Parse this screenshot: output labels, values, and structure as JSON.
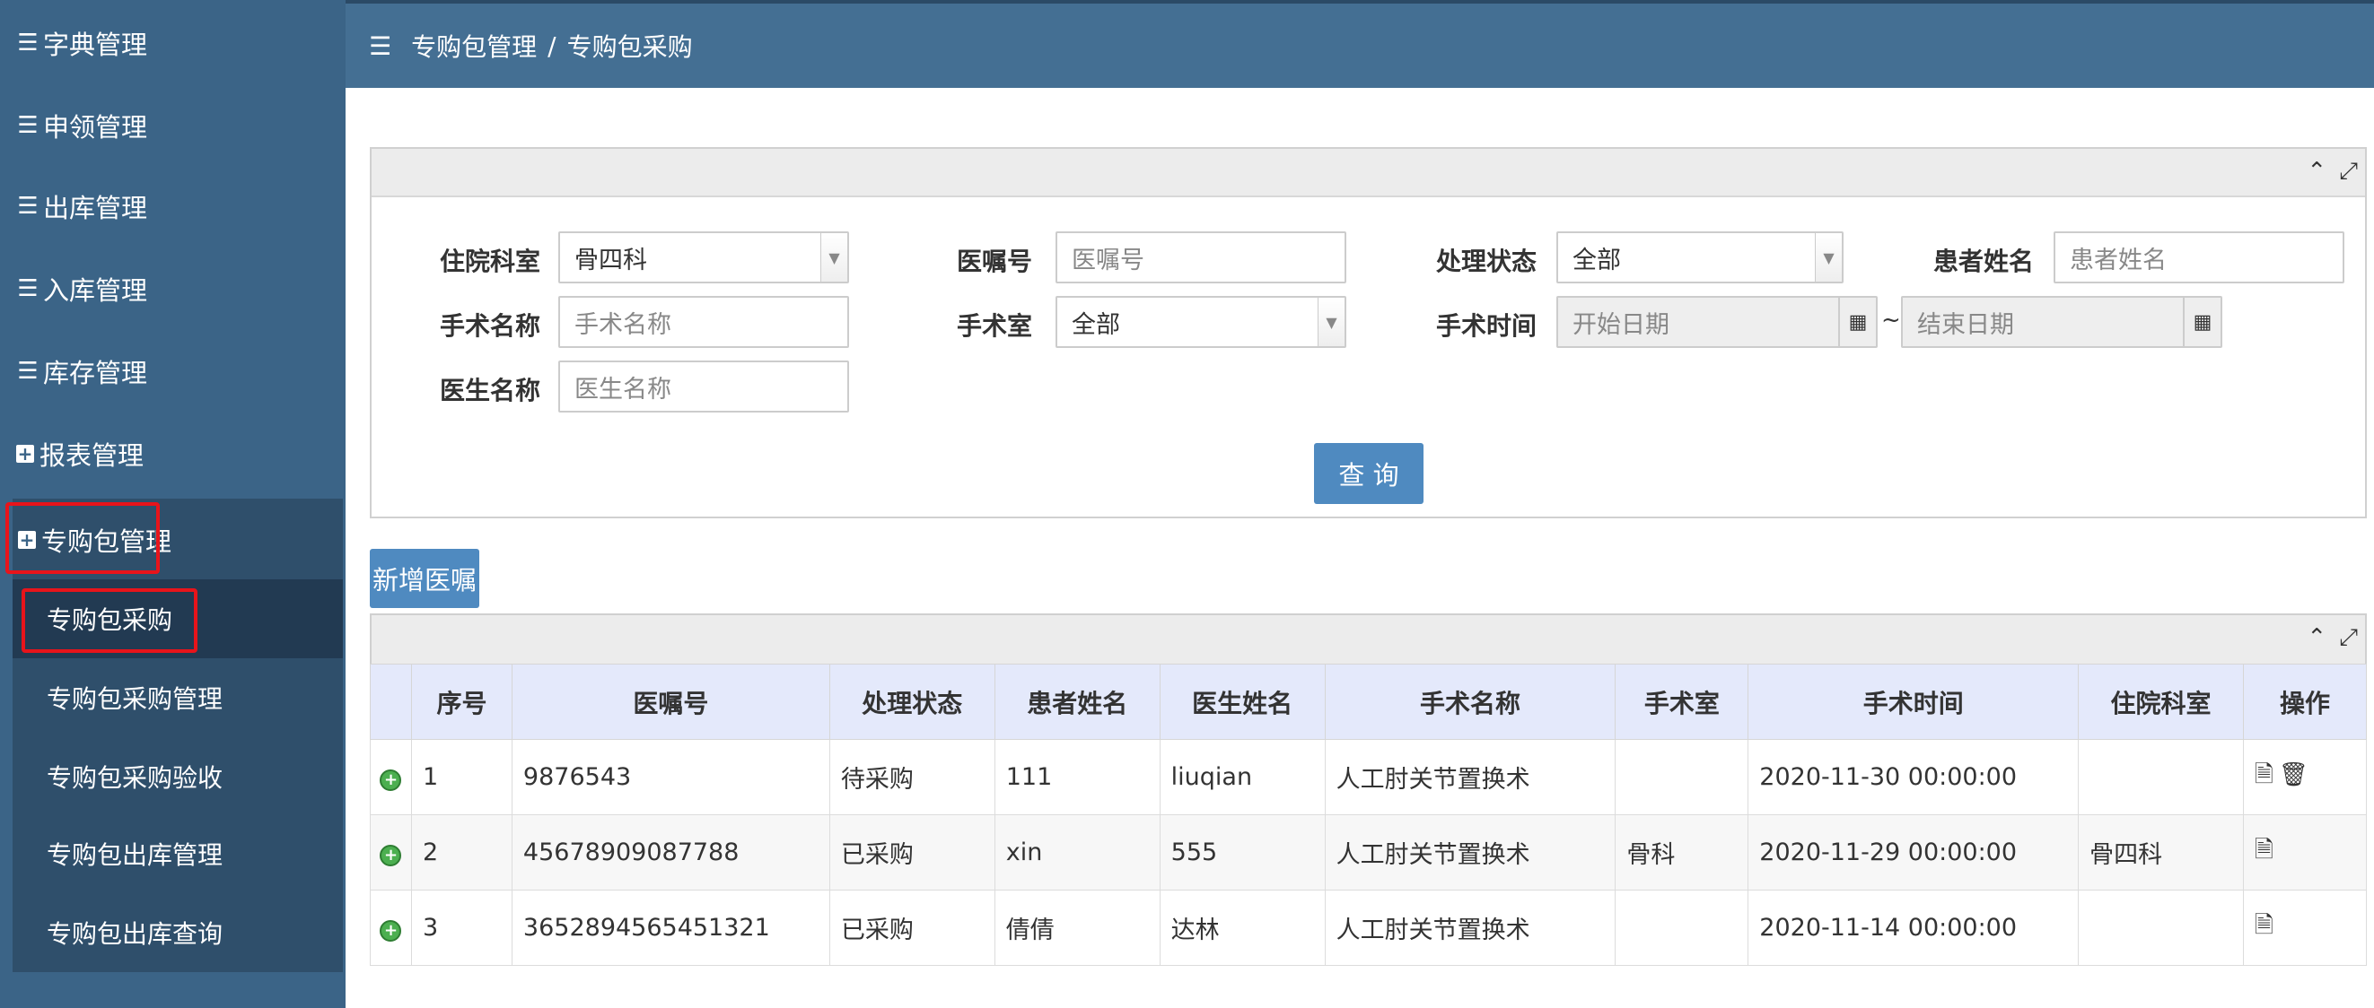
{
  "sidebar": {
    "items": [
      {
        "label": "字典管理",
        "icon": "list-icon"
      },
      {
        "label": "申领管理",
        "icon": "list-icon"
      },
      {
        "label": "出库管理",
        "icon": "list-icon"
      },
      {
        "label": "入库管理",
        "icon": "list-icon"
      },
      {
        "label": "库存管理",
        "icon": "list-icon"
      },
      {
        "label": "报表管理",
        "icon": "plus-box-icon"
      },
      {
        "label": "专购包管理",
        "icon": "plus-box-icon"
      }
    ],
    "subitems": [
      {
        "label": "专购包采购"
      },
      {
        "label": "专购包采购管理"
      },
      {
        "label": "专购包采购验收"
      },
      {
        "label": "专购包出库管理"
      },
      {
        "label": "专购包出库查询"
      }
    ]
  },
  "breadcrumb": {
    "parent": "专购包管理",
    "separator": "/",
    "current": "专购包采购"
  },
  "search": {
    "ward": {
      "label": "住院科室",
      "value": "骨四科"
    },
    "order_no": {
      "label": "医嘱号",
      "placeholder": "医嘱号"
    },
    "status": {
      "label": "处理状态",
      "value": "全部"
    },
    "patient": {
      "label": "患者姓名",
      "placeholder": "患者姓名"
    },
    "surgery": {
      "label": "手术名称",
      "placeholder": "手术名称"
    },
    "room": {
      "label": "手术室",
      "value": "全部"
    },
    "time": {
      "label": "手术时间",
      "start_placeholder": "开始日期",
      "tilde": "~",
      "end_placeholder": "结束日期"
    },
    "doctor": {
      "label": "医生名称",
      "placeholder": "医生名称"
    },
    "query_button": "查 询"
  },
  "add_button": "新增医嘱",
  "table": {
    "headers": [
      "序号",
      "医嘱号",
      "处理状态",
      "患者姓名",
      "医生姓名",
      "手术名称",
      "手术室",
      "手术时间",
      "住院科室",
      "操作"
    ],
    "rows": [
      {
        "no": "1",
        "order": "9876543",
        "status": "待采购",
        "patient": "111",
        "doctor": "liuqian",
        "surgery": "人工肘关节置换术",
        "room": "",
        "time": "2020-11-30 00:00:00",
        "ward": "",
        "ops": [
          "document-icon",
          "trash-icon"
        ]
      },
      {
        "no": "2",
        "order": "45678909087788",
        "status": "已采购",
        "patient": "xin",
        "doctor": "555",
        "surgery": "人工肘关节置换术",
        "room": "骨科",
        "time": "2020-11-29 00:00:00",
        "ward": "骨四科",
        "ops": [
          "document-icon"
        ]
      },
      {
        "no": "3",
        "order": "3652894565451321",
        "status": "已采购",
        "patient": "倩倩",
        "doctor": "达林",
        "surgery": "人工肘关节置换术",
        "room": "",
        "time": "2020-11-14 00:00:00",
        "ward": "",
        "ops": [
          "document-icon"
        ]
      }
    ]
  },
  "colors": {
    "sidebar": "#3b6487",
    "topbar": "#446f93",
    "button": "#4f8ac0",
    "highlight": "#e8141b"
  }
}
